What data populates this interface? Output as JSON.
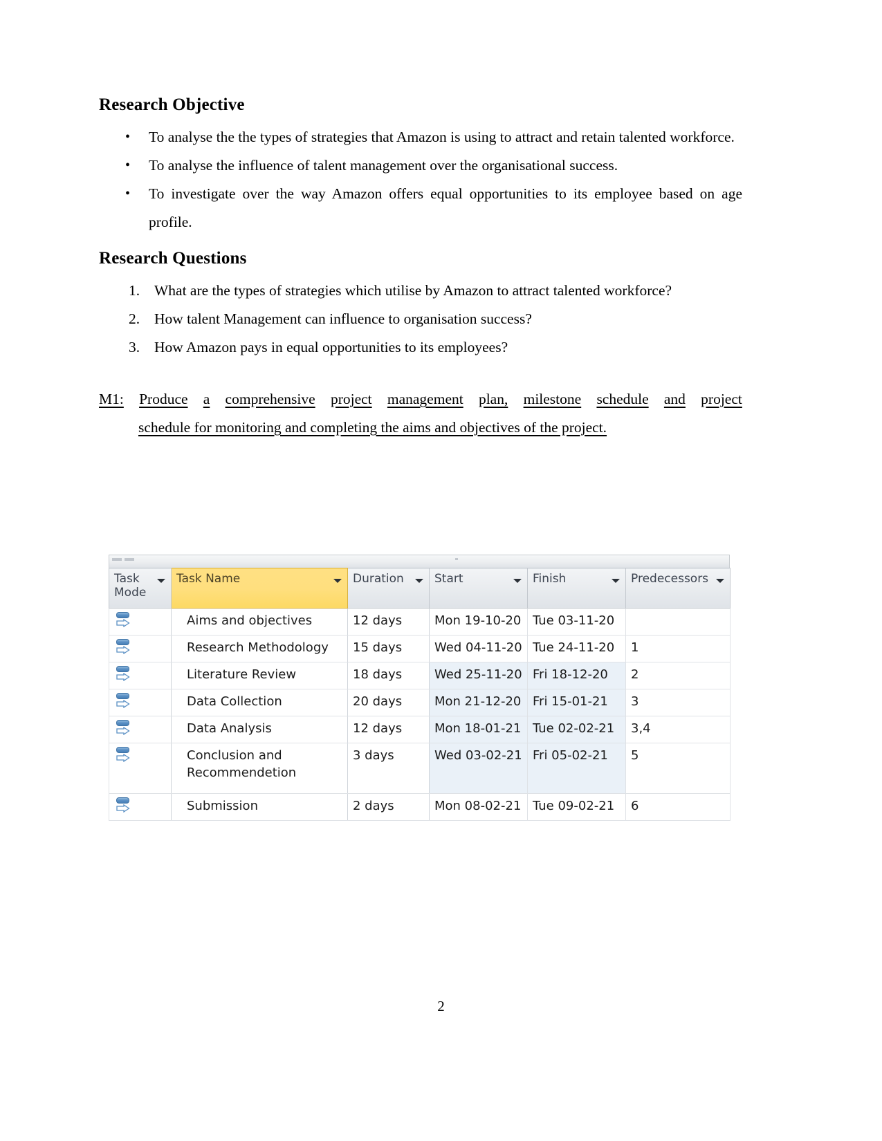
{
  "document": {
    "page_number": "2",
    "sections": [
      {
        "heading": "Research Objective",
        "bullets": [
          "To analyse the the types of strategies that Amazon is using to attract and retain talented workforce.",
          "To analyse the influence  of talent management over the organisational success.",
          "To investigate over the way Amazon offers equal opportunities to its employee based on age profile."
        ]
      },
      {
        "heading": "Research Questions",
        "items": [
          {
            "num": "1.",
            "text": "What are the types of strategies which utilise by Amazon to attract talented workforce?"
          },
          {
            "num": "2.",
            "text": "How talent Management can influence to organisation success?"
          },
          {
            "num": "3.",
            "text": "How Amazon pays in equal opportunities to its employees?"
          }
        ]
      }
    ],
    "m1_paragraph": {
      "line1_words": [
        "M1:",
        "Produce",
        "a",
        "comprehensive",
        "project",
        "management",
        "plan,",
        "milestone",
        "schedule",
        "and",
        "project"
      ],
      "line2": "schedule for monitoring and completing the aims and objectives of the project."
    }
  },
  "project_table": {
    "headers": [
      {
        "label": "Task\nMode",
        "label_l1": "Task",
        "label_l2": "Mode",
        "highlighted": false
      },
      {
        "label": "Task Name",
        "highlighted": true
      },
      {
        "label": "Duration",
        "highlighted": false
      },
      {
        "label": "Start",
        "highlighted": false
      },
      {
        "label": "Finish",
        "highlighted": false
      },
      {
        "label": "Predecessors",
        "highlighted": false
      }
    ],
    "mode_icon_name": "auto-scheduled-icon",
    "rows": [
      {
        "mode": "auto-scheduled",
        "name": "Aims and objectives",
        "duration": "12 days",
        "start": "Mon 19-10-20",
        "finish": "Tue 03-11-20",
        "predecessors": "",
        "tinted": false,
        "tall": false
      },
      {
        "mode": "auto-scheduled",
        "name": "Research Methodology",
        "duration": "15 days",
        "start": "Wed 04-11-20",
        "finish": "Tue 24-11-20",
        "predecessors": "1",
        "tinted": false,
        "tall": false
      },
      {
        "mode": "auto-scheduled",
        "name": "Literature Review",
        "duration": "18 days",
        "start": "Wed 25-11-20",
        "finish": "Fri 18-12-20",
        "predecessors": "2",
        "tinted": true,
        "tall": false
      },
      {
        "mode": "auto-scheduled",
        "name": "Data Collection",
        "duration": "20 days",
        "start": "Mon 21-12-20",
        "finish": "Fri 15-01-21",
        "predecessors": "3",
        "tinted": true,
        "tall": false
      },
      {
        "mode": "auto-scheduled",
        "name": "Data Analysis",
        "duration": "12 days",
        "start": "Mon 18-01-21",
        "finish": "Tue 02-02-21",
        "predecessors": "3,4",
        "tinted": true,
        "tall": false
      },
      {
        "mode": "auto-scheduled",
        "name": "Conclusion and Recommendetion",
        "duration": "3 days",
        "start": "Wed 03-02-21",
        "finish": "Fri 05-02-21",
        "predecessors": "5",
        "tinted": true,
        "tall": true
      },
      {
        "mode": "auto-scheduled",
        "name": "Submission",
        "duration": "2 days",
        "start": "Mon 08-02-21",
        "finish": "Tue 09-02-21",
        "predecessors": "6",
        "tinted": false,
        "tall": false
      }
    ]
  },
  "colors": {
    "header_highlight": "#ffdf7e",
    "header_gray": "#e9ecef",
    "row_tint": "#eaf1f8",
    "icon_blue": "#5b90c4"
  }
}
